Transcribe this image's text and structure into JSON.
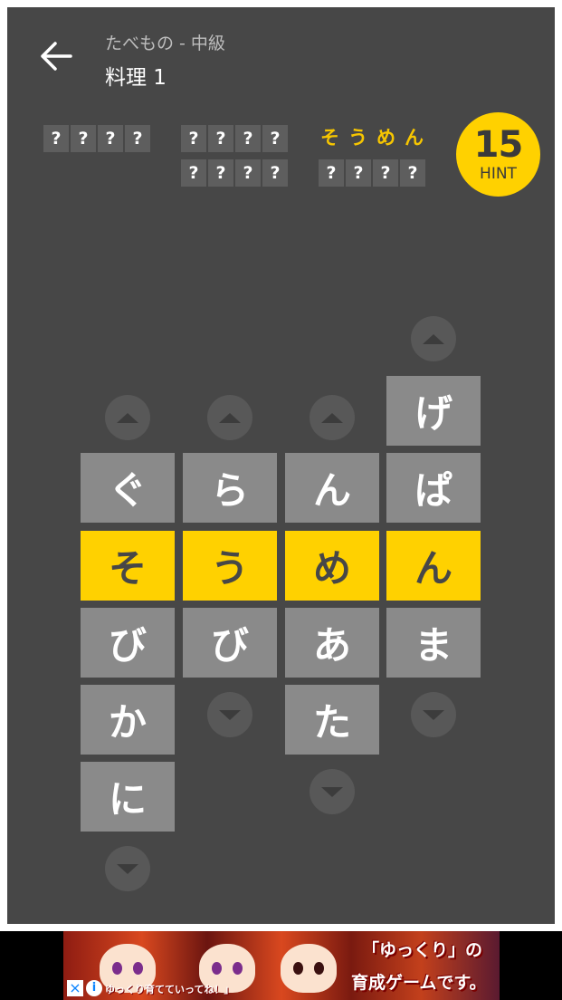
{
  "header": {
    "subtitle": "たべもの - 中級",
    "title": "料理 1",
    "back_icon": "arrow-left-icon"
  },
  "words": [
    {
      "chars": [
        "?",
        "?",
        "?",
        "?"
      ],
      "solved": false
    },
    {
      "chars": [
        "?",
        "?",
        "?",
        "?"
      ],
      "solved": false
    },
    {
      "chars": [
        "そ",
        "う",
        "め",
        "ん"
      ],
      "solved": true
    },
    {
      "chars": [
        "?",
        "?",
        "?",
        "?"
      ],
      "solved": false
    },
    {
      "chars": [
        "?",
        "?",
        "?",
        "?"
      ],
      "solved": false
    }
  ],
  "hint": {
    "count": "15",
    "label": "HINT"
  },
  "columns": [
    [
      "ぐ",
      "そ",
      "び",
      "か",
      "に"
    ],
    [
      "ら",
      "う",
      "び"
    ],
    [
      "ん",
      "め",
      "あ",
      "た"
    ],
    [
      "げ",
      "ぱ",
      "ん",
      "ま"
    ]
  ],
  "selected_row": 2,
  "colors": {
    "highlight": "#ffd100",
    "tile": "#8a8a8a",
    "background": "#474747"
  },
  "ad": {
    "headline": "「ゆっくり」の",
    "headline2": "育成ゲームです。",
    "tagline": "ゆっくり育てていってね！」",
    "close_icon": "close-icon",
    "info_icon": "info-icon"
  }
}
